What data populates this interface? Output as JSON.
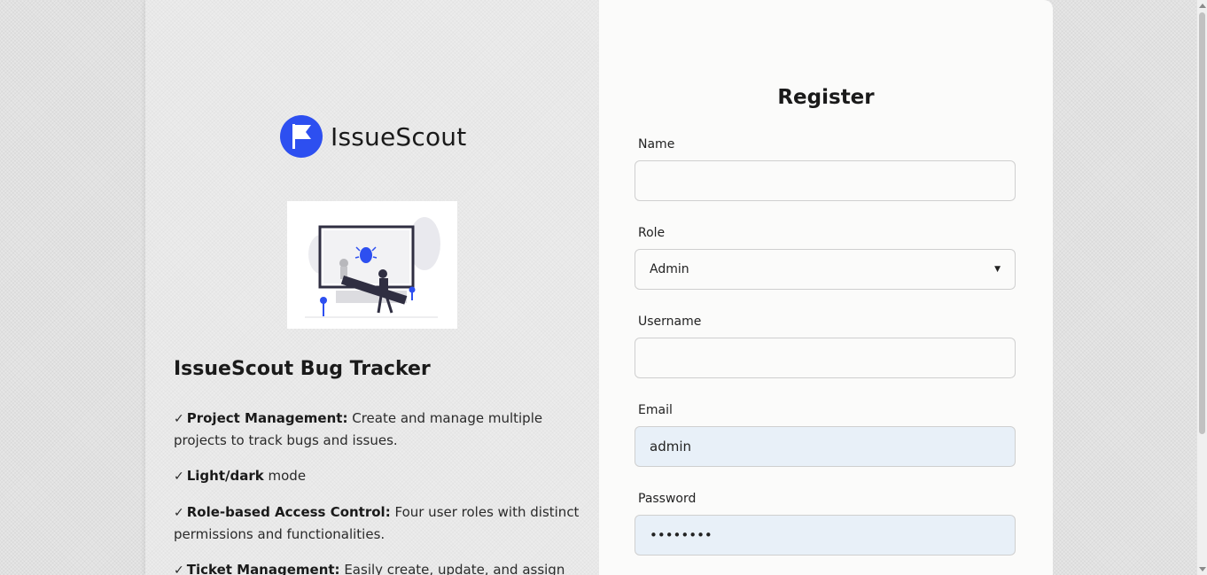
{
  "brand": {
    "name": "IssueScout",
    "accent": "#2d4ff0"
  },
  "left": {
    "tracker_title": "IssueScout Bug Tracker",
    "features": [
      {
        "title": "Project Management:",
        "text": " Create and manage multiple projects to track bugs and issues."
      },
      {
        "title": "Light/dark",
        "text": " mode"
      },
      {
        "title": "Role-based Access Control:",
        "text": " Four user roles with distinct permissions and functionalities."
      },
      {
        "title": "Ticket Management:",
        "text": " Easily create, update, and assign"
      }
    ],
    "check": "✓"
  },
  "form": {
    "title": "Register",
    "name": {
      "label": "Name",
      "value": ""
    },
    "role": {
      "label": "Role",
      "value": "Admin"
    },
    "username": {
      "label": "Username",
      "value": ""
    },
    "email": {
      "label": "Email",
      "value": "admin"
    },
    "password": {
      "label": "Password",
      "value": "••••••••"
    }
  }
}
